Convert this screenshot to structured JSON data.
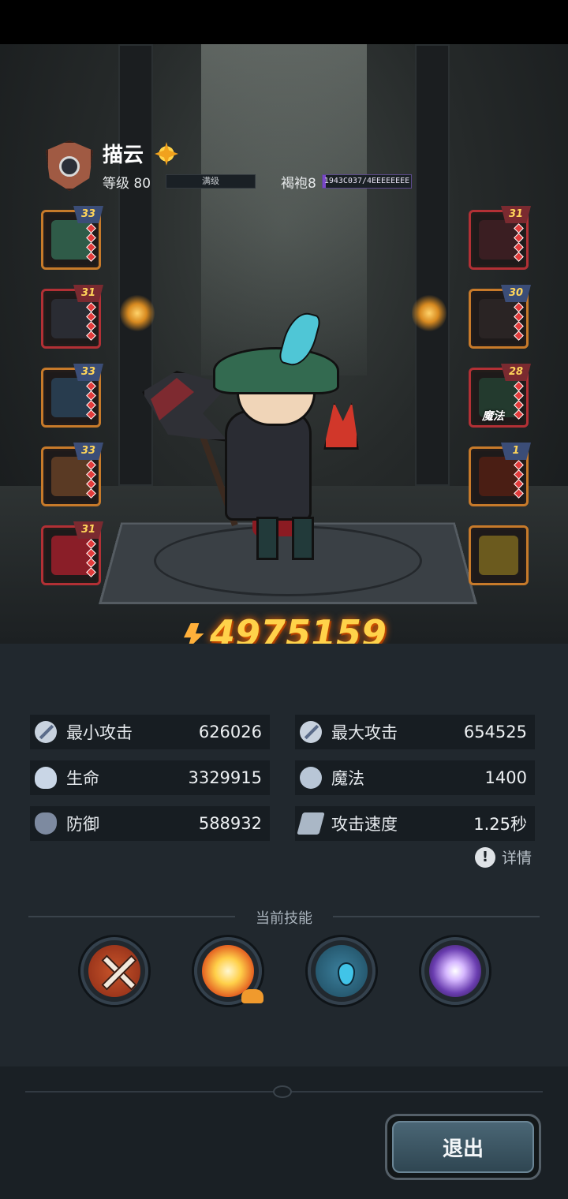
{
  "profile": {
    "name": "描云",
    "level_label": "等级 80",
    "level_status": "满级",
    "rank_label": "褐袍8",
    "rank_progress_text": "1943C037/4EEEEEEEE",
    "rank_progress_fraction": 0.04
  },
  "equipment": {
    "left": [
      {
        "level": "33",
        "name": "hat-slot"
      },
      {
        "level": "31",
        "name": "chest-armor-slot"
      },
      {
        "level": "33",
        "name": "gloves-slot"
      },
      {
        "level": "33",
        "name": "boots-slot"
      },
      {
        "level": "31",
        "name": "cape-slot"
      }
    ],
    "right": [
      {
        "level": "31",
        "name": "weapon-slot"
      },
      {
        "level": "30",
        "name": "ring-slot"
      },
      {
        "level": "28",
        "name": "magic-necklace-slot",
        "tag": "魔法"
      },
      {
        "level": "1",
        "name": "rune-slot"
      },
      {
        "level": "",
        "name": "lightning-slot"
      }
    ]
  },
  "combat_power": "4975159",
  "stats": [
    {
      "label": "最小攻击",
      "value": "626026",
      "icon": "sword-icon"
    },
    {
      "label": "最大攻击",
      "value": "654525",
      "icon": "sword-icon"
    },
    {
      "label": "生命",
      "value": "3329915",
      "icon": "heart-icon"
    },
    {
      "label": "魔法",
      "value": "1400",
      "icon": "magic-swirl-icon"
    },
    {
      "label": "防御",
      "value": "588932",
      "icon": "shield-icon"
    },
    {
      "label": "攻击速度",
      "value": "1.25秒",
      "icon": "wing-icon"
    }
  ],
  "details_label": "详情",
  "skills_title": "当前技能",
  "skills": [
    "crossed-axes-skill-icon",
    "explosion-skill-icon",
    "water-shield-skill-icon",
    "shadow-burst-skill-icon"
  ],
  "exit_label": "退出",
  "colors": {
    "power_text": "#ffd24a",
    "rank_bar": "#7a47c9",
    "slot_orange": "#c77a2a",
    "slot_red": "#b23035"
  }
}
